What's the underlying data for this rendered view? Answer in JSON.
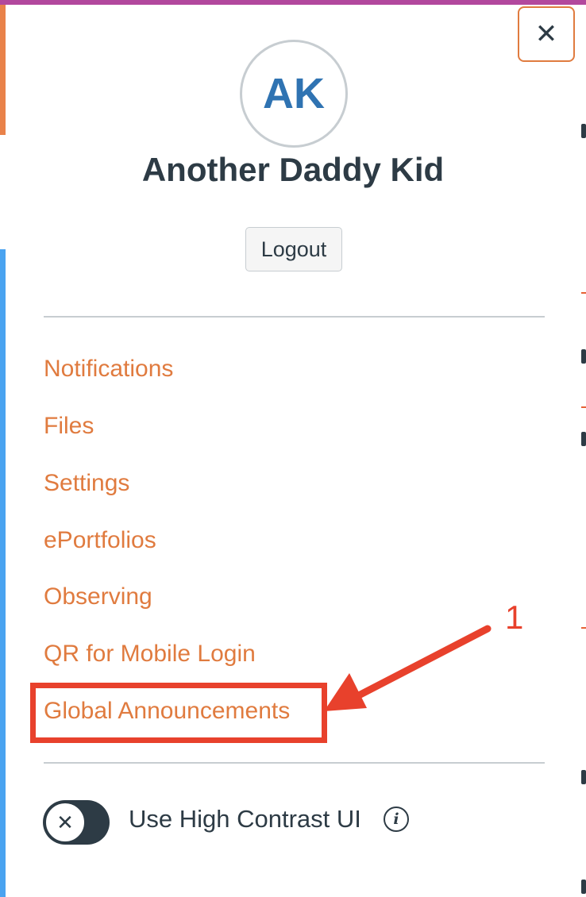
{
  "colors": {
    "top_bar": "#b2489d",
    "left_accent_orange": "#e9824a",
    "left_accent_blue": "#4aa3f0",
    "link": "#e07b3f",
    "avatar_initials": "#2f73b2",
    "close_border": "#e07b3f",
    "annotation": "#e8412c"
  },
  "close_button": {
    "icon": "close-icon",
    "glyph": "✕"
  },
  "profile": {
    "initials": "AK",
    "name": "Another Daddy Kid",
    "logout_label": "Logout"
  },
  "menu": {
    "items": [
      {
        "label": "Notifications"
      },
      {
        "label": "Files"
      },
      {
        "label": "Settings"
      },
      {
        "label": "ePortfolios"
      },
      {
        "label": "Observing"
      },
      {
        "label": "QR for Mobile Login"
      },
      {
        "label": "Global Announcements"
      }
    ]
  },
  "annotation": {
    "step_number": "1",
    "highlighted_item": "Global Announcements"
  },
  "high_contrast": {
    "label": "Use High Contrast UI",
    "enabled": false,
    "toggle_icon": "x-icon",
    "info_icon": "info-icon"
  }
}
